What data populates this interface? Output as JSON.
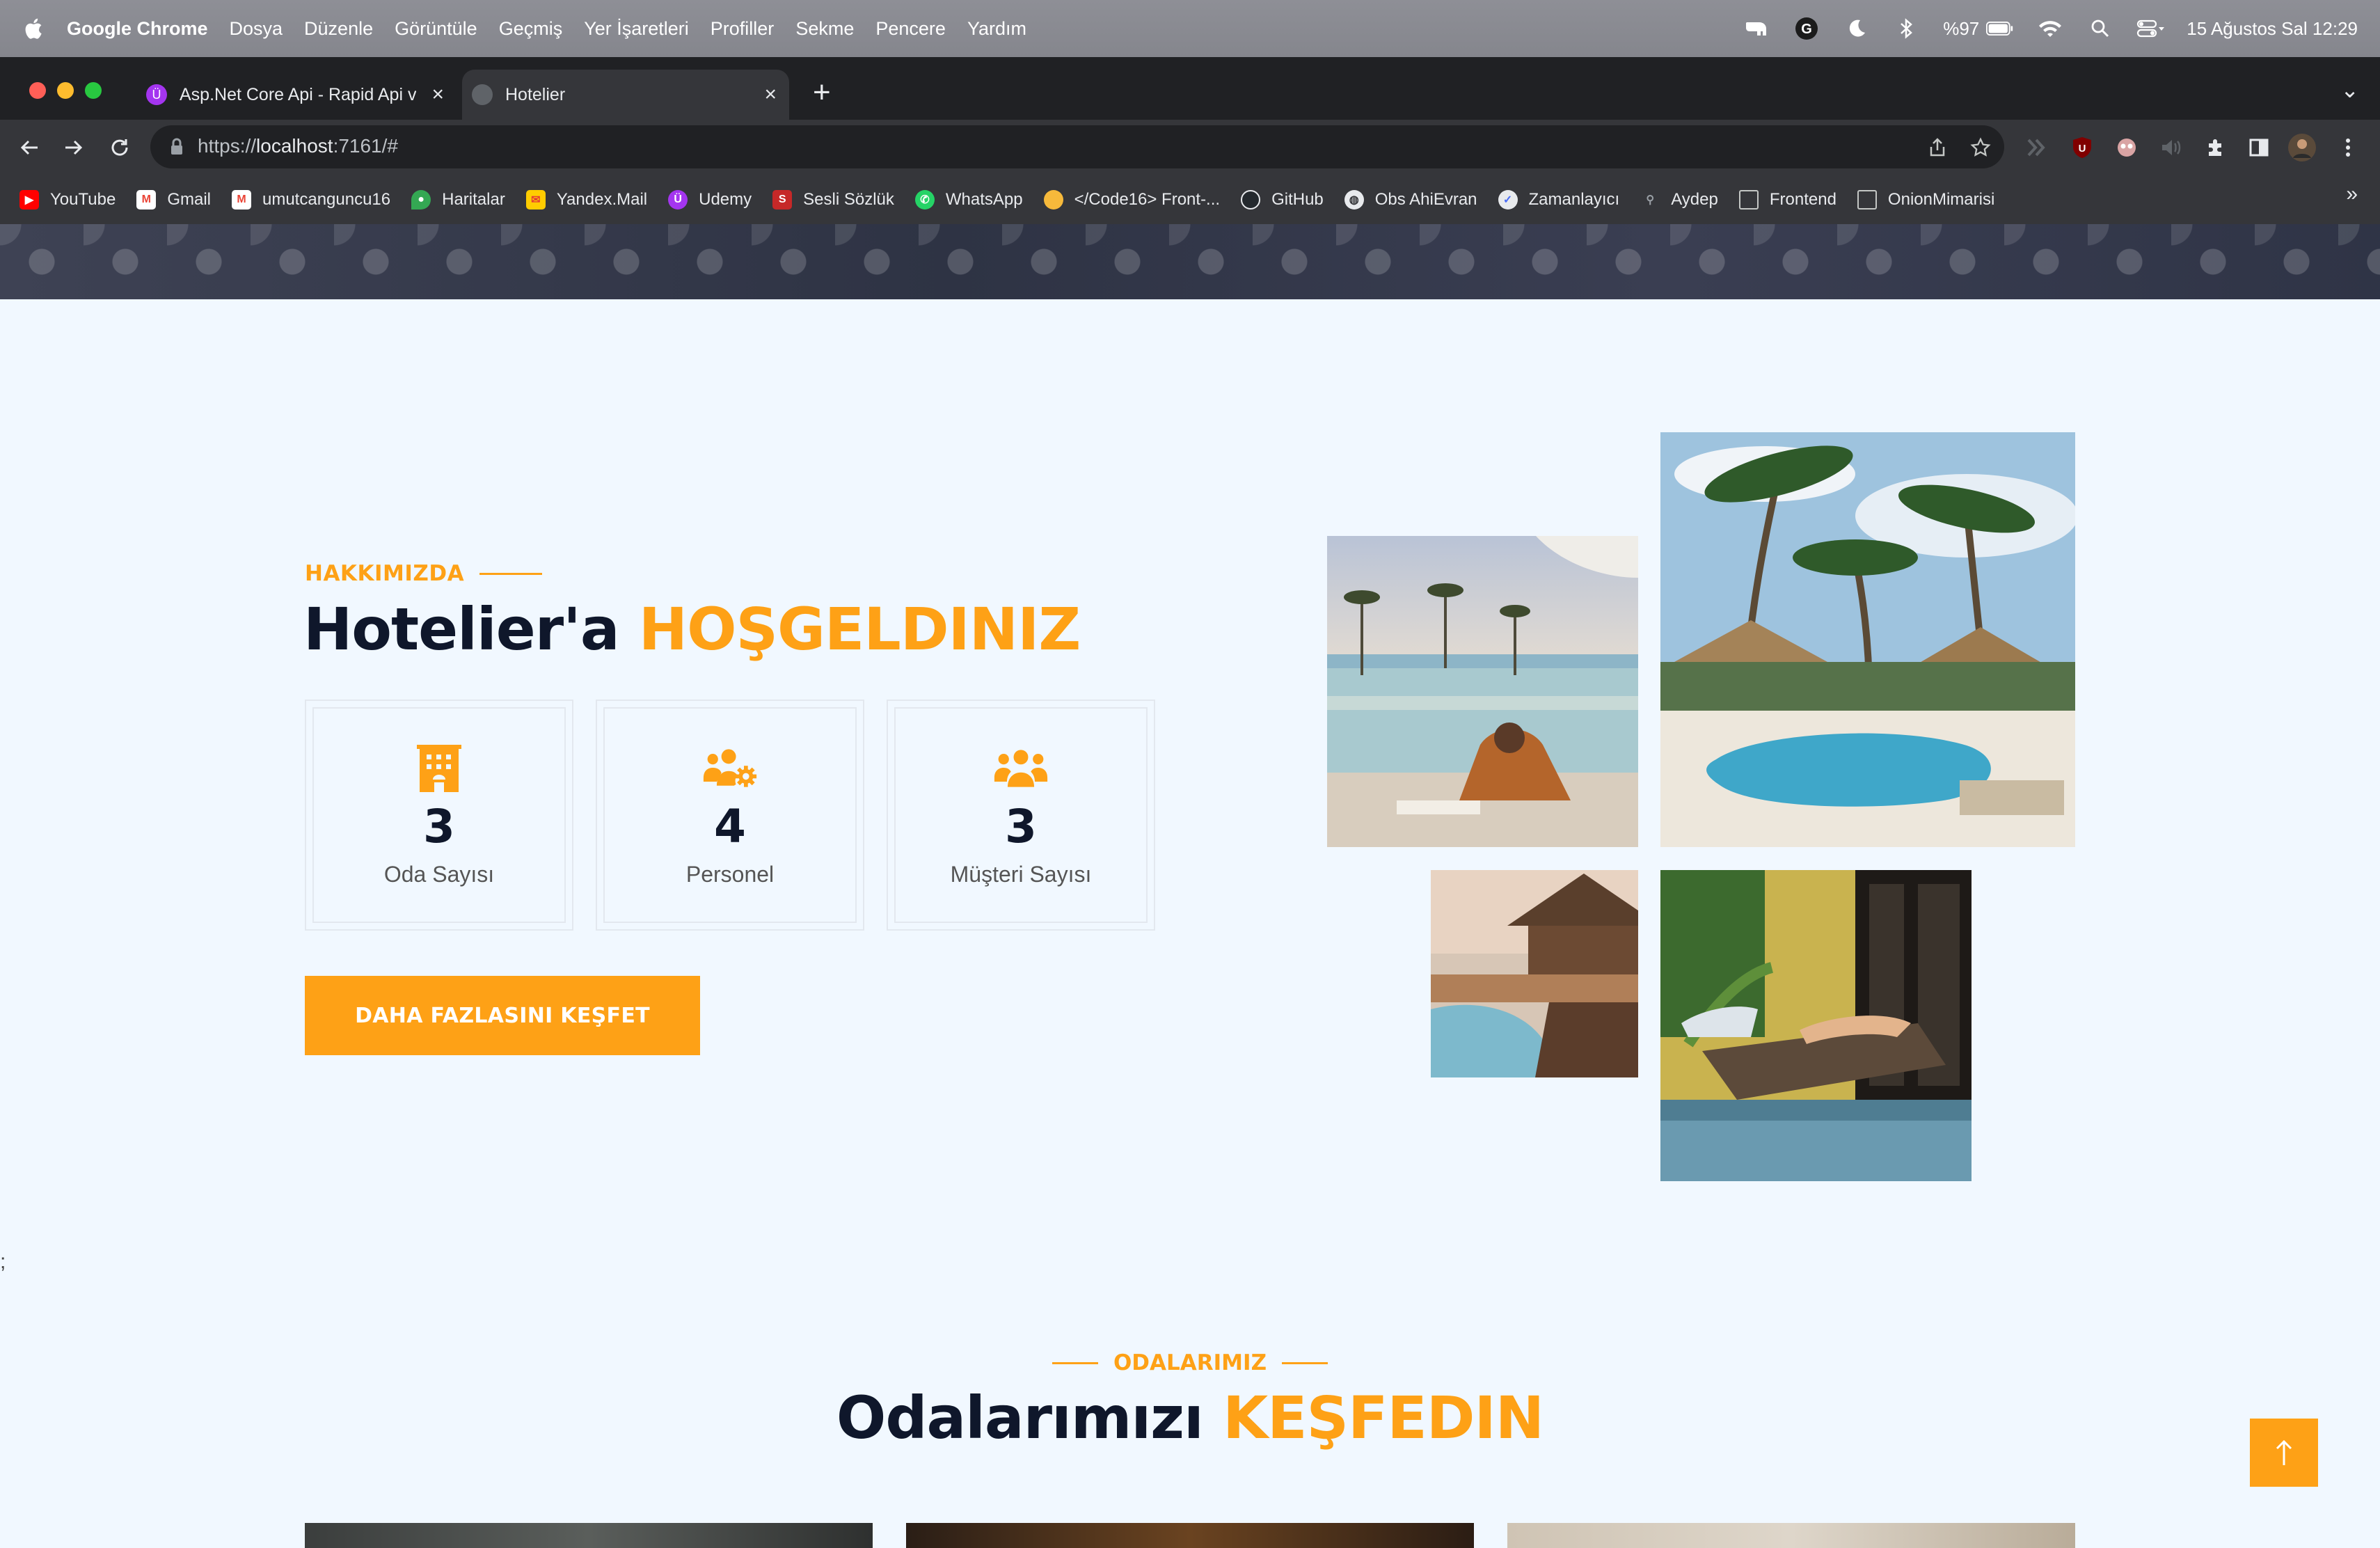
{
  "menubar": {
    "app_name": "Google Chrome",
    "items": [
      "Dosya",
      "Düzenle",
      "Görüntüle",
      "Geçmiş",
      "Yer İşaretleri",
      "Profiller",
      "Sekme",
      "Pencere",
      "Yardım"
    ],
    "battery": "%97",
    "datetime": "15 Ağustos Sal  12:29"
  },
  "tabs": [
    {
      "label": "Asp.Net Core Api - Rapid Api v",
      "favicon": "udemy-icon",
      "favicon_color": "#A435F0"
    },
    {
      "label": "Hotelier",
      "favicon": "globe-icon",
      "favicon_color": "#5F6368"
    }
  ],
  "address_bar": {
    "scheme": "https://",
    "host": "localhost",
    "rest": ":7161/#"
  },
  "bookmarks": [
    {
      "label": "YouTube",
      "icon": "youtube-icon",
      "color": "#FF0000"
    },
    {
      "label": "Gmail",
      "icon": "gmail-icon",
      "color": "#EA4335"
    },
    {
      "label": "umutcanguncu16",
      "icon": "gmail-icon",
      "color": "#EA4335"
    },
    {
      "label": "Haritalar",
      "icon": "maps-icon",
      "color": "#34A853"
    },
    {
      "label": "Yandex.Mail",
      "icon": "mail-icon",
      "color": "#FFCC00"
    },
    {
      "label": "Udemy",
      "icon": "udemy-icon",
      "color": "#A435F0"
    },
    {
      "label": "Sesli Sözlük",
      "icon": "dictionary-icon",
      "color": "#C62828"
    },
    {
      "label": "WhatsApp",
      "icon": "whatsapp-icon",
      "color": "#25D366"
    },
    {
      "label": "</Code16> Front-...",
      "icon": "code-icon",
      "color": "#F6B93B"
    },
    {
      "label": "GitHub",
      "icon": "github-icon",
      "color": "#333333"
    },
    {
      "label": "Obs AhiEvran",
      "icon": "globe-icon",
      "color": "#E8EAED"
    },
    {
      "label": "Zamanlayıcı",
      "icon": "timer-icon",
      "color": "#4A6CF7"
    },
    {
      "label": "Aydep",
      "icon": "person-icon",
      "color": "#3C4043"
    },
    {
      "label": "Frontend",
      "icon": "folder-icon",
      "color": "#E8EAED"
    },
    {
      "label": "OnionMimarisi",
      "icon": "folder-icon",
      "color": "#E8EAED"
    }
  ],
  "about": {
    "eyebrow": "HAKKIMIZDA",
    "title_main": "Hotelier'a ",
    "title_accent": "HOŞGELDINIZ",
    "stats": [
      {
        "value": "3",
        "label": "Oda Sayısı",
        "icon": "hotel-icon"
      },
      {
        "value": "4",
        "label": "Personel",
        "icon": "users-cog-icon"
      },
      {
        "value": "3",
        "label": "Müşteri Sayısı",
        "icon": "users-icon"
      }
    ],
    "cta_label": "DAHA FAZLASINI KEŞFET"
  },
  "stray_text": ";",
  "rooms": {
    "eyebrow": "ODALARIMIZ",
    "title_main": "Odalarımızı ",
    "title_accent": "KEŞFEDIN"
  },
  "colors": {
    "accent": "#FEA116",
    "dark": "#0F172B",
    "page_bg": "#F1F8FF"
  }
}
